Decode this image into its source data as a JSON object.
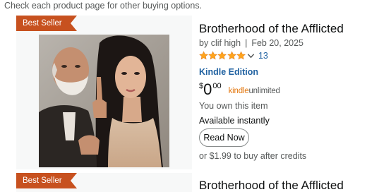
{
  "notice": "Check each product page for other buying options.",
  "results": [
    {
      "badge": "Best Seller",
      "title": "Brotherhood of the Afflicted",
      "author_prefix": "by",
      "author": "clif high",
      "separator": "|",
      "date": "Feb 20, 2025",
      "rating": {
        "stars": 5,
        "count": "13"
      },
      "format": "Kindle Edition",
      "price": {
        "symbol": "$",
        "whole": "0",
        "fraction": "00"
      },
      "kindle_unlimited": {
        "part1": "kindle",
        "part2": "unlimited"
      },
      "ownership": "You own this item",
      "availability": "Available instantly",
      "read_button": "Read Now",
      "credits_offer": "or $1.99 to buy after credits"
    },
    {
      "badge": "Best Seller",
      "title": "Brotherhood of the Afflicted"
    }
  ],
  "colors": {
    "badge": "#c7511f",
    "star": "#ffa41c",
    "link": "#2162a1",
    "kindle_unlimited": "#e47911"
  }
}
